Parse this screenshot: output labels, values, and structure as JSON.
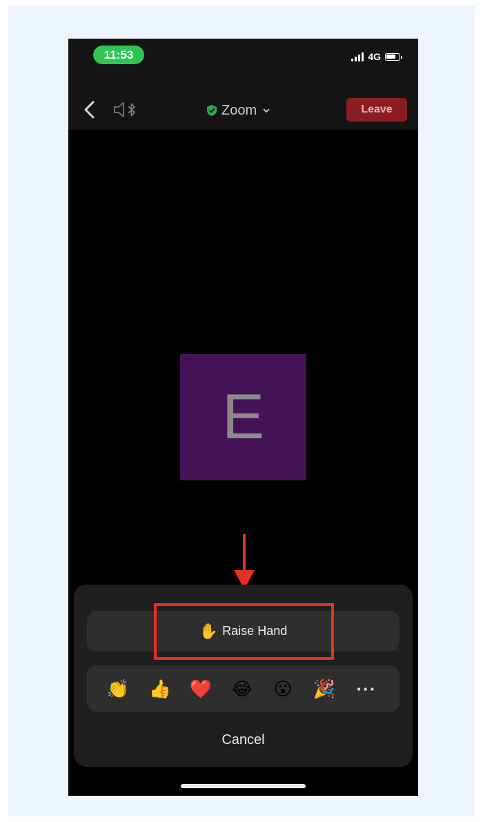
{
  "status_bar": {
    "time": "11:53",
    "network": "4G",
    "signal_icon": "cellular-signal-icon",
    "battery_icon": "battery-icon"
  },
  "nav": {
    "back_icon": "chevron-left-icon",
    "audio_icon": "speaker-bluetooth-icon",
    "title": "Zoom",
    "title_icon": "shield-check-icon",
    "title_chevron": "chevron-down-icon",
    "leave_label": "Leave"
  },
  "participant": {
    "initial": "E",
    "tile_color": "#451255"
  },
  "reaction_sheet": {
    "raise_hand_emoji": "✋",
    "raise_hand_label": "Raise Hand",
    "reactions": [
      "👏",
      "👍",
      "❤️",
      "😂",
      "😮",
      "🎉"
    ],
    "more_label": "···",
    "cancel_label": "Cancel"
  },
  "annotation": {
    "highlight_color": "#e8301f"
  }
}
